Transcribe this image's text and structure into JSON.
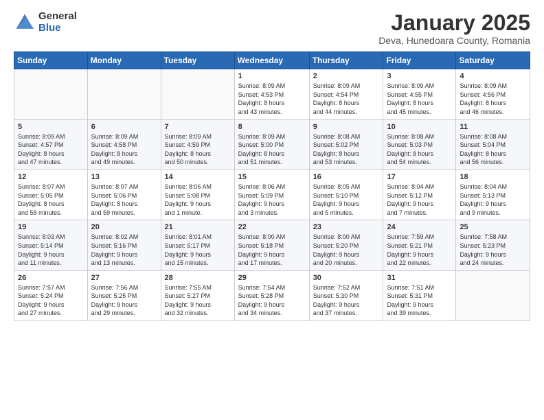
{
  "header": {
    "logo_general": "General",
    "logo_blue": "Blue",
    "month_title": "January 2025",
    "subtitle": "Deva, Hunedoara County, Romania"
  },
  "days_of_week": [
    "Sunday",
    "Monday",
    "Tuesday",
    "Wednesday",
    "Thursday",
    "Friday",
    "Saturday"
  ],
  "weeks": [
    [
      {
        "day": "",
        "info": ""
      },
      {
        "day": "",
        "info": ""
      },
      {
        "day": "",
        "info": ""
      },
      {
        "day": "1",
        "info": "Sunrise: 8:09 AM\nSunset: 4:53 PM\nDaylight: 8 hours\nand 43 minutes."
      },
      {
        "day": "2",
        "info": "Sunrise: 8:09 AM\nSunset: 4:54 PM\nDaylight: 8 hours\nand 44 minutes."
      },
      {
        "day": "3",
        "info": "Sunrise: 8:09 AM\nSunset: 4:55 PM\nDaylight: 8 hours\nand 45 minutes."
      },
      {
        "day": "4",
        "info": "Sunrise: 8:09 AM\nSunset: 4:56 PM\nDaylight: 8 hours\nand 46 minutes."
      }
    ],
    [
      {
        "day": "5",
        "info": "Sunrise: 8:09 AM\nSunset: 4:57 PM\nDaylight: 8 hours\nand 47 minutes."
      },
      {
        "day": "6",
        "info": "Sunrise: 8:09 AM\nSunset: 4:58 PM\nDaylight: 8 hours\nand 49 minutes."
      },
      {
        "day": "7",
        "info": "Sunrise: 8:09 AM\nSunset: 4:59 PM\nDaylight: 8 hours\nand 50 minutes."
      },
      {
        "day": "8",
        "info": "Sunrise: 8:09 AM\nSunset: 5:00 PM\nDaylight: 8 hours\nand 51 minutes."
      },
      {
        "day": "9",
        "info": "Sunrise: 8:08 AM\nSunset: 5:02 PM\nDaylight: 8 hours\nand 53 minutes."
      },
      {
        "day": "10",
        "info": "Sunrise: 8:08 AM\nSunset: 5:03 PM\nDaylight: 8 hours\nand 54 minutes."
      },
      {
        "day": "11",
        "info": "Sunrise: 8:08 AM\nSunset: 5:04 PM\nDaylight: 8 hours\nand 56 minutes."
      }
    ],
    [
      {
        "day": "12",
        "info": "Sunrise: 8:07 AM\nSunset: 5:05 PM\nDaylight: 8 hours\nand 58 minutes."
      },
      {
        "day": "13",
        "info": "Sunrise: 8:07 AM\nSunset: 5:06 PM\nDaylight: 8 hours\nand 59 minutes."
      },
      {
        "day": "14",
        "info": "Sunrise: 8:06 AM\nSunset: 5:08 PM\nDaylight: 9 hours\nand 1 minute."
      },
      {
        "day": "15",
        "info": "Sunrise: 8:06 AM\nSunset: 5:09 PM\nDaylight: 9 hours\nand 3 minutes."
      },
      {
        "day": "16",
        "info": "Sunrise: 8:05 AM\nSunset: 5:10 PM\nDaylight: 9 hours\nand 5 minutes."
      },
      {
        "day": "17",
        "info": "Sunrise: 8:04 AM\nSunset: 5:12 PM\nDaylight: 9 hours\nand 7 minutes."
      },
      {
        "day": "18",
        "info": "Sunrise: 8:04 AM\nSunset: 5:13 PM\nDaylight: 9 hours\nand 9 minutes."
      }
    ],
    [
      {
        "day": "19",
        "info": "Sunrise: 8:03 AM\nSunset: 5:14 PM\nDaylight: 9 hours\nand 11 minutes."
      },
      {
        "day": "20",
        "info": "Sunrise: 8:02 AM\nSunset: 5:16 PM\nDaylight: 9 hours\nand 13 minutes."
      },
      {
        "day": "21",
        "info": "Sunrise: 8:01 AM\nSunset: 5:17 PM\nDaylight: 9 hours\nand 15 minutes."
      },
      {
        "day": "22",
        "info": "Sunrise: 8:00 AM\nSunset: 5:18 PM\nDaylight: 9 hours\nand 17 minutes."
      },
      {
        "day": "23",
        "info": "Sunrise: 8:00 AM\nSunset: 5:20 PM\nDaylight: 9 hours\nand 20 minutes."
      },
      {
        "day": "24",
        "info": "Sunrise: 7:59 AM\nSunset: 5:21 PM\nDaylight: 9 hours\nand 22 minutes."
      },
      {
        "day": "25",
        "info": "Sunrise: 7:58 AM\nSunset: 5:23 PM\nDaylight: 9 hours\nand 24 minutes."
      }
    ],
    [
      {
        "day": "26",
        "info": "Sunrise: 7:57 AM\nSunset: 5:24 PM\nDaylight: 9 hours\nand 27 minutes."
      },
      {
        "day": "27",
        "info": "Sunrise: 7:56 AM\nSunset: 5:25 PM\nDaylight: 9 hours\nand 29 minutes."
      },
      {
        "day": "28",
        "info": "Sunrise: 7:55 AM\nSunset: 5:27 PM\nDaylight: 9 hours\nand 32 minutes."
      },
      {
        "day": "29",
        "info": "Sunrise: 7:54 AM\nSunset: 5:28 PM\nDaylight: 9 hours\nand 34 minutes."
      },
      {
        "day": "30",
        "info": "Sunrise: 7:52 AM\nSunset: 5:30 PM\nDaylight: 9 hours\nand 37 minutes."
      },
      {
        "day": "31",
        "info": "Sunrise: 7:51 AM\nSunset: 5:31 PM\nDaylight: 9 hours\nand 39 minutes."
      },
      {
        "day": "",
        "info": ""
      }
    ]
  ]
}
